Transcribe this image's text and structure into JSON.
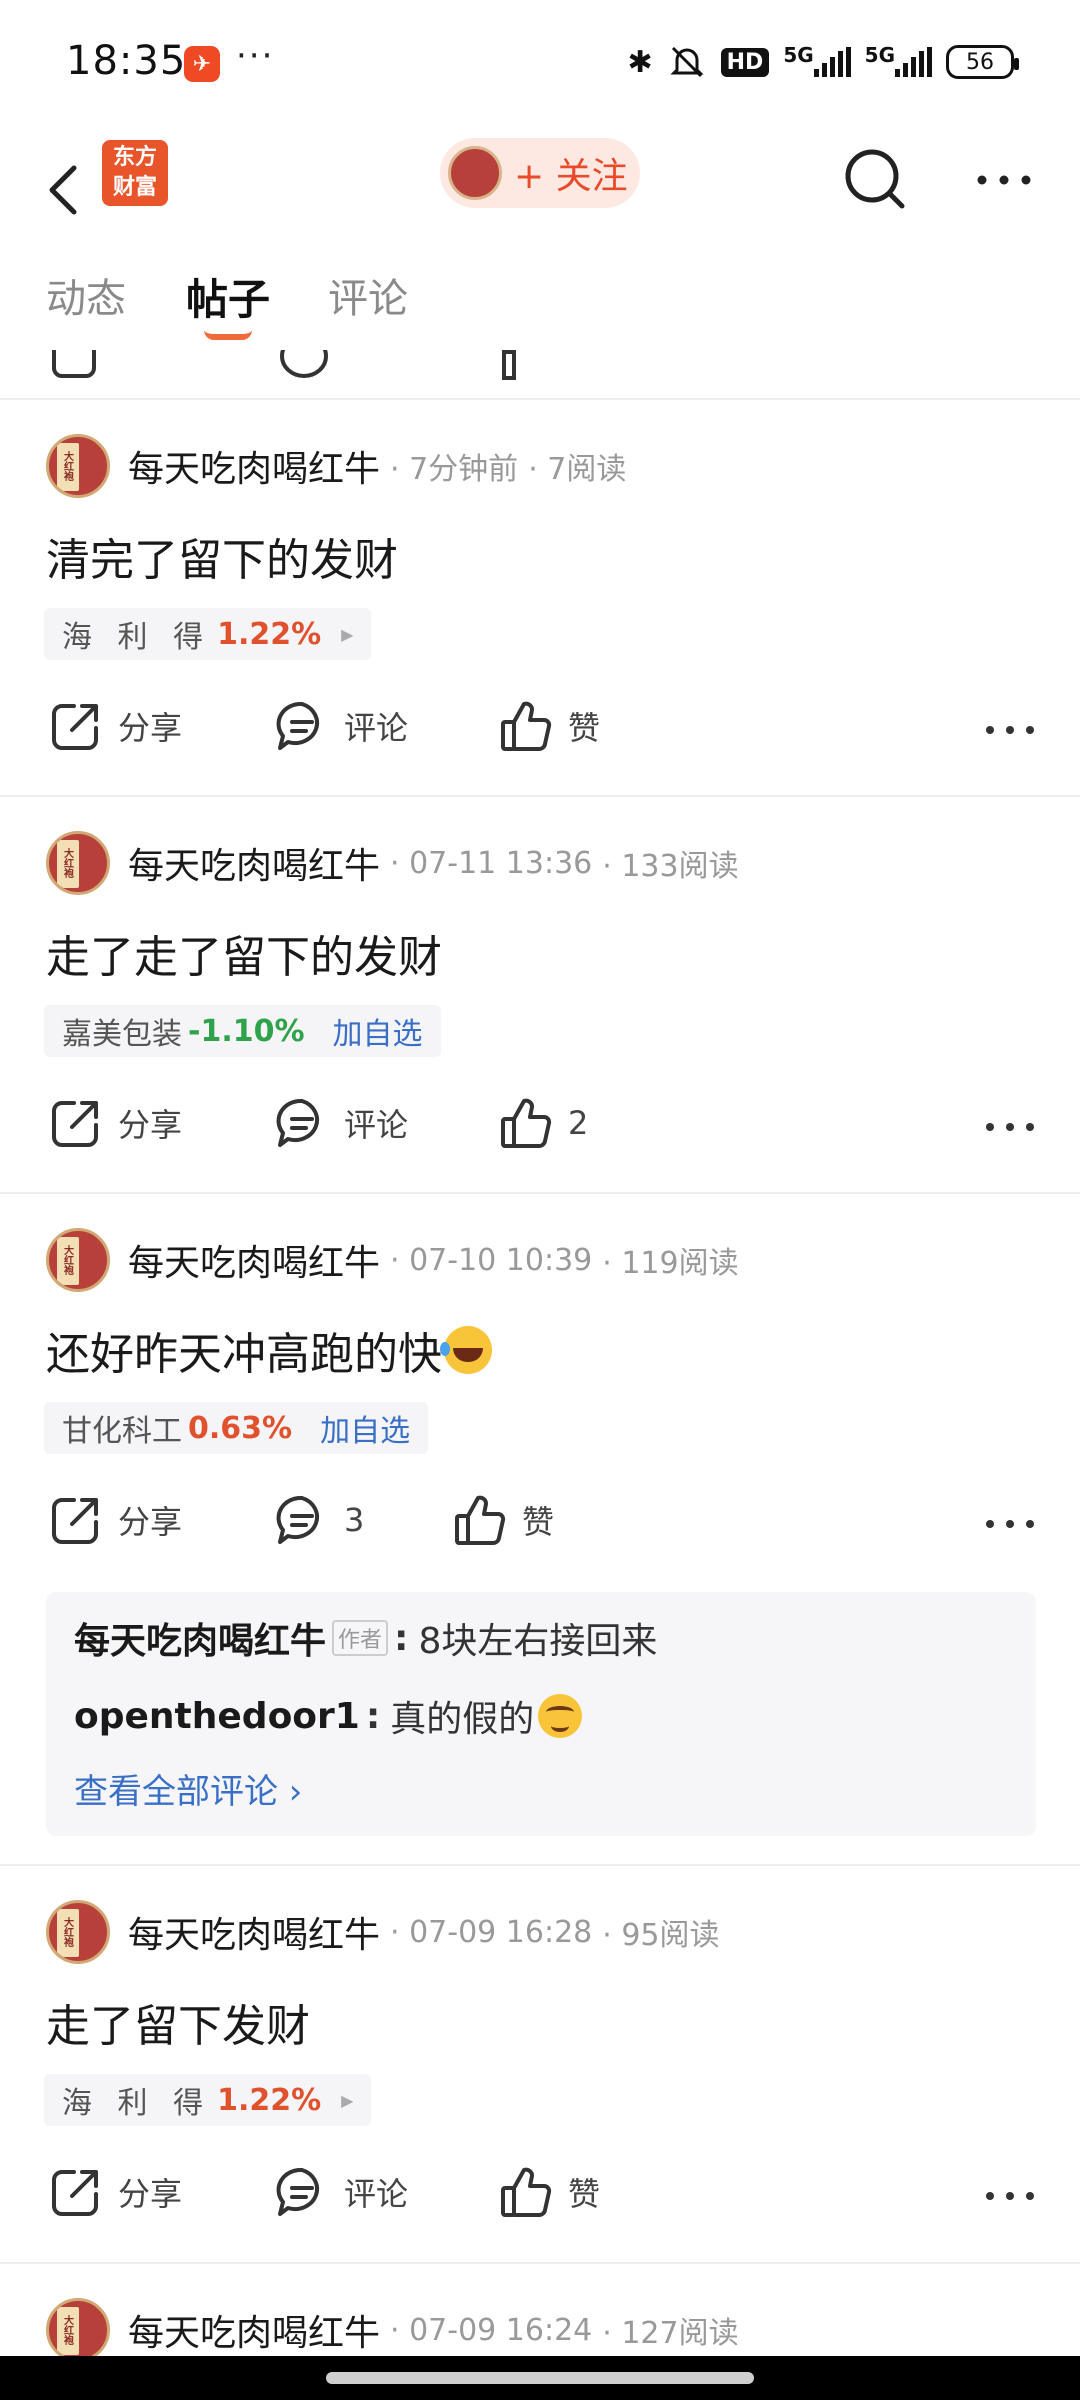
{
  "status_bar": {
    "time": "18:35",
    "app_notification_icon": "dongfang-caifu-icon",
    "more_dots": "···",
    "hd_label": "HD",
    "network_1": "5G",
    "network_2": "5G",
    "battery": "56"
  },
  "header": {
    "logo_text_line1": "东方",
    "logo_text_line2": "财富",
    "follow_label": "+ 关注",
    "avatar_text": "大红袍",
    "accent_color": "#e94b2a"
  },
  "tabs": [
    {
      "label": "动态",
      "active": false
    },
    {
      "label": "帖子",
      "active": true
    },
    {
      "label": "评论",
      "active": false
    }
  ],
  "posts": [
    {
      "author": "每天吃肉喝红牛",
      "time": "· 7分钟前",
      "reads": "· 7阅读",
      "content": "清完了留下的发财",
      "stock": {
        "name": "海 利 得",
        "change": "1.22%",
        "direction": "up",
        "action": "▶"
      },
      "actions": {
        "share": "分享",
        "comment": "评论",
        "like": "赞"
      }
    },
    {
      "author": "每天吃肉喝红牛",
      "time": "· 07-11 13:36",
      "reads": "· 133阅读",
      "content": "走了走了留下的发财",
      "stock": {
        "name": "嘉美包装",
        "change": "-1.10%",
        "direction": "down",
        "action": "加自选"
      },
      "actions": {
        "share": "分享",
        "comment": "评论",
        "like": "2"
      }
    },
    {
      "author": "每天吃肉喝红牛",
      "time": "· 07-10 10:39",
      "reads": "· 119阅读",
      "content": "还好昨天冲高跑的快",
      "stock": {
        "name": "甘化科工",
        "change": "0.63%",
        "direction": "up",
        "action": "加自选"
      },
      "actions": {
        "share": "分享",
        "comment": "3",
        "like": "赞"
      },
      "comments": [
        {
          "author": "每天吃肉喝红牛",
          "badge": "作者",
          "text": "8块左右接回来"
        },
        {
          "author": "openthedoor1",
          "text": "真的假的"
        }
      ],
      "view_all": "查看全部评论 ›"
    },
    {
      "author": "每天吃肉喝红牛",
      "time": "· 07-09 16:28",
      "reads": "· 95阅读",
      "content": "走了留下发财",
      "stock": {
        "name": "海 利 得",
        "change": "1.22%",
        "direction": "up",
        "action": "▶"
      },
      "actions": {
        "share": "分享",
        "comment": "评论",
        "like": "赞"
      }
    },
    {
      "author": "每天吃肉喝红牛",
      "time": "· 07-09 16:24",
      "reads": "· 127阅读"
    }
  ]
}
